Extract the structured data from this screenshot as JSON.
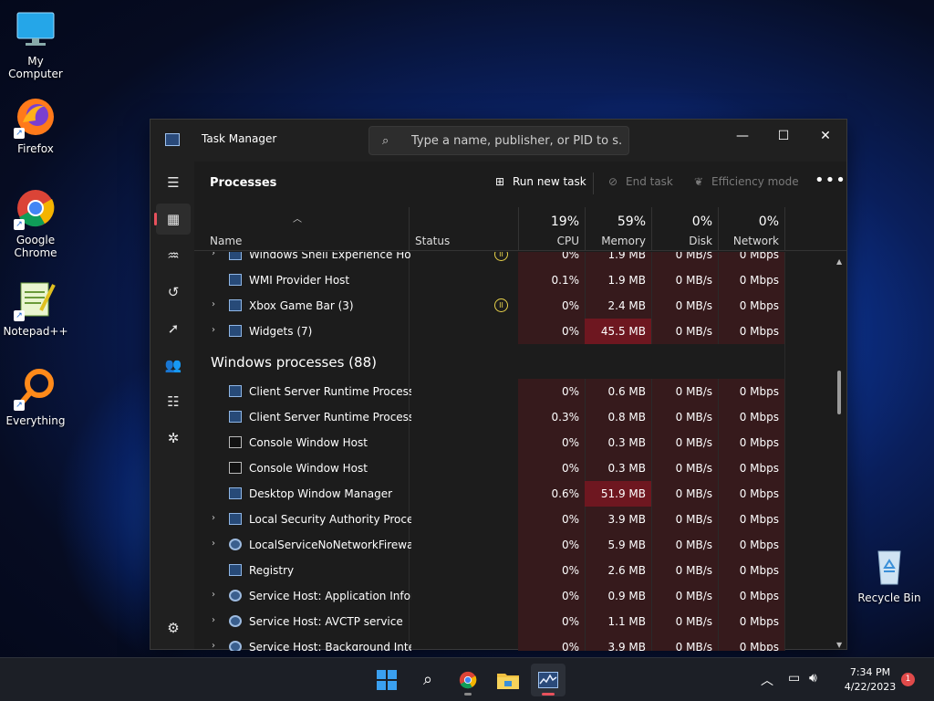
{
  "desktop": {
    "icons": [
      {
        "label": "My Computer"
      },
      {
        "label": "Firefox"
      },
      {
        "label": "Google Chrome"
      },
      {
        "label": "Notepad++"
      },
      {
        "label": "Everything"
      },
      {
        "label": "Recycle Bin"
      }
    ]
  },
  "window": {
    "title": "Task Manager",
    "search_placeholder": "Type a name, publisher, or PID to s...",
    "controls": {
      "minimize": "—",
      "maximize": "☐",
      "close": "✕"
    }
  },
  "toolbar": {
    "page_title": "Processes",
    "run_new_task": "Run new task",
    "end_task": "End task",
    "efficiency_mode": "Efficiency mode",
    "more": "•••"
  },
  "columns": {
    "name": "Name",
    "status": "Status",
    "cpu": {
      "label": "CPU",
      "pct": "19%"
    },
    "memory": {
      "label": "Memory",
      "pct": "59%"
    },
    "disk": {
      "label": "Disk",
      "pct": "0%"
    },
    "network": {
      "label": "Network",
      "pct": "0%"
    }
  },
  "rows": [
    {
      "name": "Windows Shell Experience Ho...",
      "expand": true,
      "icon": "window",
      "status": "paused",
      "cpu": "0%",
      "mem": "1.9 MB",
      "disk": "0 MB/s",
      "net": "0 Mbps",
      "mem_hi": false
    },
    {
      "name": "WMI Provider Host",
      "expand": false,
      "icon": "window",
      "status": "",
      "cpu": "0.1%",
      "mem": "1.9 MB",
      "disk": "0 MB/s",
      "net": "0 Mbps",
      "mem_hi": false
    },
    {
      "name": "Xbox Game Bar (3)",
      "expand": true,
      "icon": "window",
      "status": "paused",
      "cpu": "0%",
      "mem": "2.4 MB",
      "disk": "0 MB/s",
      "net": "0 Mbps",
      "mem_hi": false
    },
    {
      "name": "Widgets (7)",
      "expand": true,
      "icon": "window",
      "status": "",
      "cpu": "0%",
      "mem": "45.5 MB",
      "disk": "0 MB/s",
      "net": "0 Mbps",
      "mem_hi": true
    }
  ],
  "group": {
    "label": "Windows processes (88)"
  },
  "rows2": [
    {
      "name": "Client Server Runtime Process",
      "expand": false,
      "icon": "window",
      "cpu": "0%",
      "mem": "0.6 MB",
      "disk": "0 MB/s",
      "net": "0 Mbps",
      "mem_hi": false
    },
    {
      "name": "Client Server Runtime Process",
      "expand": false,
      "icon": "window",
      "cpu": "0.3%",
      "mem": "0.8 MB",
      "disk": "0 MB/s",
      "net": "0 Mbps",
      "mem_hi": false
    },
    {
      "name": "Console Window Host",
      "expand": false,
      "icon": "console",
      "cpu": "0%",
      "mem": "0.3 MB",
      "disk": "0 MB/s",
      "net": "0 Mbps",
      "mem_hi": false
    },
    {
      "name": "Console Window Host",
      "expand": false,
      "icon": "console",
      "cpu": "0%",
      "mem": "0.3 MB",
      "disk": "0 MB/s",
      "net": "0 Mbps",
      "mem_hi": false
    },
    {
      "name": "Desktop Window Manager",
      "expand": false,
      "icon": "window",
      "cpu": "0.6%",
      "mem": "51.9 MB",
      "disk": "0 MB/s",
      "net": "0 Mbps",
      "mem_hi": true
    },
    {
      "name": "Local Security Authority Proce...",
      "expand": true,
      "icon": "window",
      "cpu": "0%",
      "mem": "3.9 MB",
      "disk": "0 MB/s",
      "net": "0 Mbps",
      "mem_hi": false
    },
    {
      "name": "LocalServiceNoNetworkFirewa...",
      "expand": true,
      "icon": "gear",
      "cpu": "0%",
      "mem": "5.9 MB",
      "disk": "0 MB/s",
      "net": "0 Mbps",
      "mem_hi": false
    },
    {
      "name": "Registry",
      "expand": false,
      "icon": "window",
      "cpu": "0%",
      "mem": "2.6 MB",
      "disk": "0 MB/s",
      "net": "0 Mbps",
      "mem_hi": false
    },
    {
      "name": "Service Host: Application Infor...",
      "expand": true,
      "icon": "gear",
      "cpu": "0%",
      "mem": "0.9 MB",
      "disk": "0 MB/s",
      "net": "0 Mbps",
      "mem_hi": false
    },
    {
      "name": "Service Host: AVCTP service",
      "expand": true,
      "icon": "gear",
      "cpu": "0%",
      "mem": "1.1 MB",
      "disk": "0 MB/s",
      "net": "0 Mbps",
      "mem_hi": false
    },
    {
      "name": "Service Host: Background Inte...",
      "expand": true,
      "icon": "gear",
      "cpu": "0%",
      "mem": "3.9 MB",
      "disk": "0 MB/s",
      "net": "0 Mbps",
      "mem_hi": false
    }
  ],
  "taskbar": {
    "clock_time": "7:34 PM",
    "clock_date": "4/22/2023",
    "notification_count": "1"
  },
  "colors": {
    "accent_red": "#e8515c",
    "memory_high": "#6e1720",
    "cpu_tint": "#3a1a1c",
    "paused_yellow": "#e8d24a"
  }
}
